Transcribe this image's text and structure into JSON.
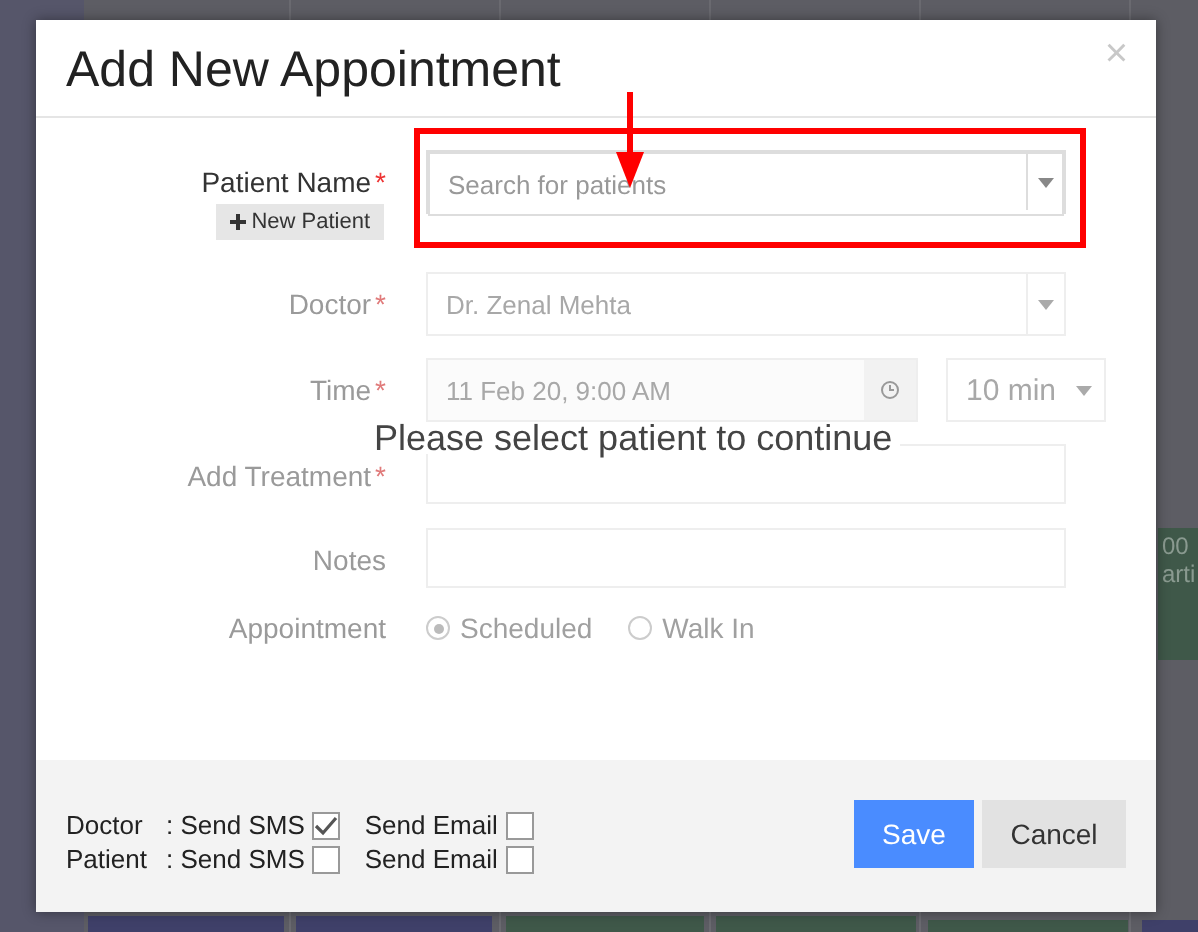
{
  "background_events": [
    {
      "line1": "00",
      "line2": "arti"
    }
  ],
  "dialog": {
    "title": "Add New Appointment",
    "close": "×",
    "required_mark": "*",
    "patient": {
      "label": "Patient Name",
      "required": true,
      "placeholder": "Search for patients",
      "new_patient_button": "New Patient"
    },
    "fields": [
      {
        "kind": "select",
        "label": "Doctor",
        "required": true,
        "value": "Dr. Zenal Mehta"
      },
      {
        "kind": "time",
        "label": "Time",
        "required": true,
        "value": "11 Feb 20, 9:00 AM",
        "duration": "10 min"
      },
      {
        "kind": "text",
        "label": "Add Treatment",
        "required": true
      },
      {
        "kind": "text",
        "label": "Notes",
        "required": false
      },
      {
        "kind": "radio",
        "label": "Appointment",
        "options": [
          {
            "label": "Scheduled",
            "selected": true
          },
          {
            "label": "Walk In",
            "selected": false
          }
        ]
      }
    ],
    "overlay_message": "Please select patient to continue",
    "notifications": [
      {
        "role": "Doctor",
        "sms_label": ": Send SMS",
        "sms_checked": true,
        "email_label": "Send Email",
        "email_checked": false
      },
      {
        "role": "Patient",
        "sms_label": ": Send SMS",
        "sms_checked": false,
        "email_label": "Send Email",
        "email_checked": false
      }
    ],
    "buttons": [
      {
        "label": "Save",
        "kind": "primary"
      },
      {
        "label": "Cancel",
        "kind": "default"
      }
    ]
  }
}
